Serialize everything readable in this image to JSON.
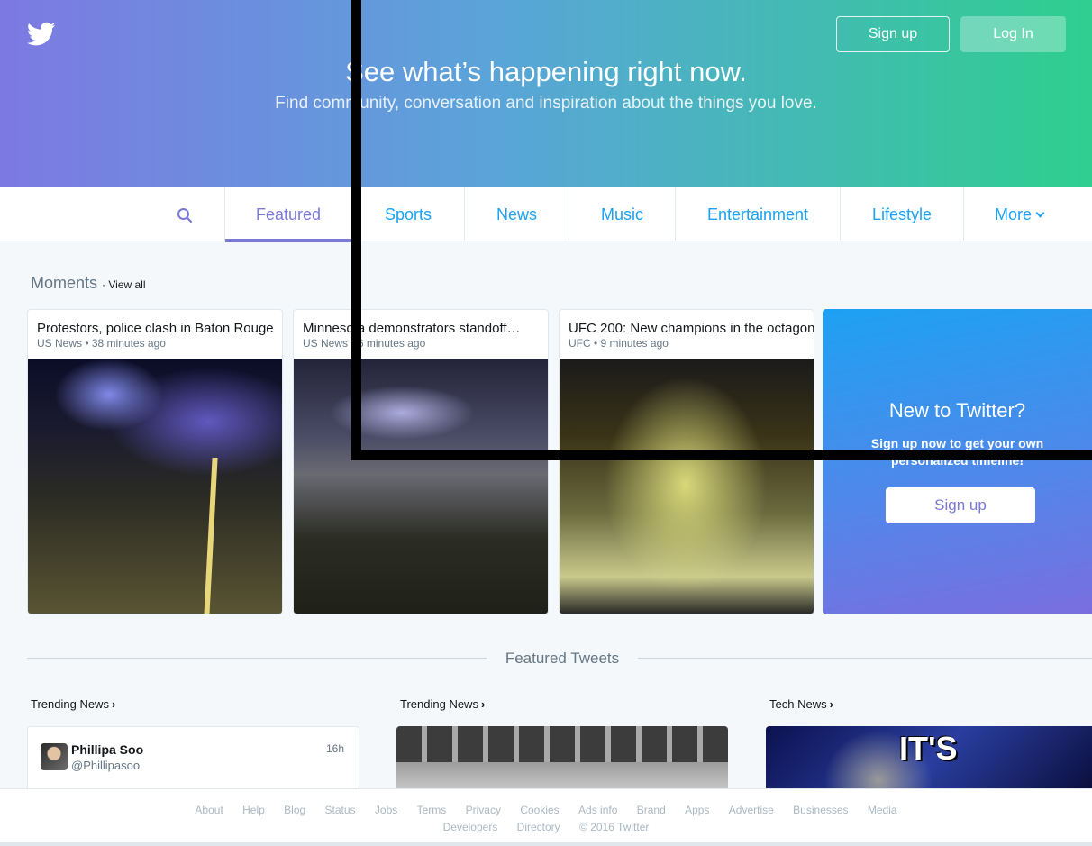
{
  "colors": {
    "accent": "#7a78d8",
    "link": "#1da1f2",
    "muted": "#657786"
  },
  "hero": {
    "logo_icon": "twitter-bird-icon",
    "title": "See what’s happening right now.",
    "subtitle": "Find community, conversation and inspiration about the things you love.",
    "signup_label": "Sign up",
    "login_label": "Log In"
  },
  "nav": {
    "search_icon": "search-icon",
    "tabs": [
      "Featured",
      "Sports",
      "News",
      "Music",
      "Entertainment",
      "Lifestyle",
      "More"
    ],
    "active_tab": "Featured"
  },
  "moments": {
    "heading": "Moments",
    "view_all": "· View all",
    "cards": [
      {
        "title": "Protestors, police clash in Baton Rouge",
        "meta": "US News • 38 minutes ago"
      },
      {
        "title": "Minnesota demonstrators standoff…",
        "meta": "US News • 6 minutes ago"
      },
      {
        "title": "UFC 200: New champions in the octagon",
        "meta": "UFC • 9 minutes ago"
      }
    ]
  },
  "signup_card": {
    "title": "New to Twitter?",
    "subtitle": "Sign up now to get your own personalized timeline!",
    "button": "Sign up"
  },
  "featured": {
    "heading": "Featured Tweets",
    "columns": [
      "Trending News",
      "Trending News",
      "Tech News"
    ],
    "tweet": {
      "name": "Phillipa Soo",
      "handle": "@Phillipasoo",
      "time": "16h"
    },
    "media_caption": "IT'S"
  },
  "footer": {
    "row1": [
      "About",
      "Help",
      "Blog",
      "Status",
      "Jobs",
      "Terms",
      "Privacy",
      "Cookies",
      "Ads info",
      "Brand",
      "Apps",
      "Advertise",
      "Businesses",
      "Media"
    ],
    "row2": [
      "Developers",
      "Directory",
      "© 2016 Twitter"
    ]
  }
}
